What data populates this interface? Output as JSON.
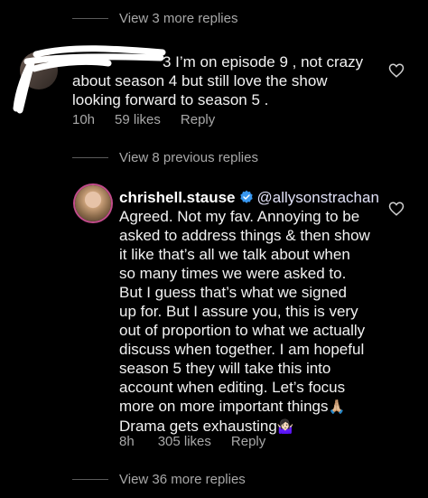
{
  "thread1": {
    "view_more": "View 3 more replies"
  },
  "comment1": {
    "text_line1": "3 I’m on episode 9 , not crazy",
    "text_line2": "about season 4 but still love the show",
    "text_line3": "looking forward to season 5 .",
    "time": "10h",
    "likes": "59 likes",
    "reply": "Reply"
  },
  "thread2": {
    "view_previous": "View 8 previous replies"
  },
  "comment2": {
    "username": "chrishell.stause",
    "mention": "@allysonstrachan",
    "lines": [
      "Agreed. Not my fav. Annoying to be",
      "asked to address things & then show",
      "it like that’s all we talk about when",
      "so many times we were asked to.",
      "But I guess that’s what we signed",
      "up for. But I assure you, this is very",
      "out of proportion to what we actually",
      "discuss when together. I am hopeful",
      "season 5 they will take this into",
      "account when editing. Let’s focus",
      "more on more important things",
      "Drama gets exhausting"
    ],
    "emoji1": "🙏🏼",
    "emoji2": "🤷🏻‍♀️",
    "time": "8h",
    "likes": "305 likes",
    "reply": "Reply"
  },
  "thread3": {
    "view_more": "View 36 more replies"
  },
  "colors": {
    "background": "#000000",
    "muted": "#a8a8a8",
    "verified_blue": "#3897f0"
  },
  "icons": [
    "heart-icon",
    "verified-badge-icon"
  ]
}
